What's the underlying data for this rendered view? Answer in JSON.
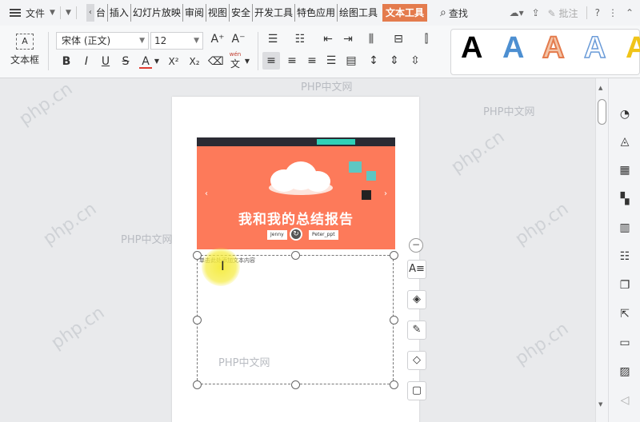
{
  "menu": {
    "file_label": "文件",
    "tabs": [
      "台",
      "插入",
      "幻灯片放映",
      "审阅",
      "视图",
      "安全",
      "开发工具",
      "特色应用",
      "绘图工具"
    ],
    "active_tab": "文本工具",
    "search_label": "查找",
    "comment_label": "批注"
  },
  "ribbon": {
    "textbox_label": "文本框",
    "textbox_icon_text": "A",
    "font_name": "宋体 (正文)",
    "font_size": "12",
    "wen_label": "wén",
    "wen_char": "文",
    "style_letter": "A",
    "format_bold": "B",
    "format_italic": "I",
    "format_underline": "U",
    "format_strike": "S",
    "format_color": "A",
    "format_sup": "X²",
    "format_sub": "X₂",
    "grow_font": "A⁺",
    "shrink_font": "A⁻"
  },
  "slide": {
    "title": "我和我的总结报告",
    "button_left": "Jenny",
    "button_right": "Peter_ppt"
  },
  "textbox_content": "单击此处添加文本内容",
  "watermarks": {
    "wm1": "PHP中文网",
    "wm2": "PHP中文网",
    "wm3": "PHP中文网",
    "wm4": "PHP中文网",
    "diag": "php.cn"
  },
  "colors": {
    "active_tab": "#e47b4d",
    "slide_bg": "#fd7a5a",
    "style_blue": "#4d8fd1",
    "style_orange": "#e47b4d"
  }
}
